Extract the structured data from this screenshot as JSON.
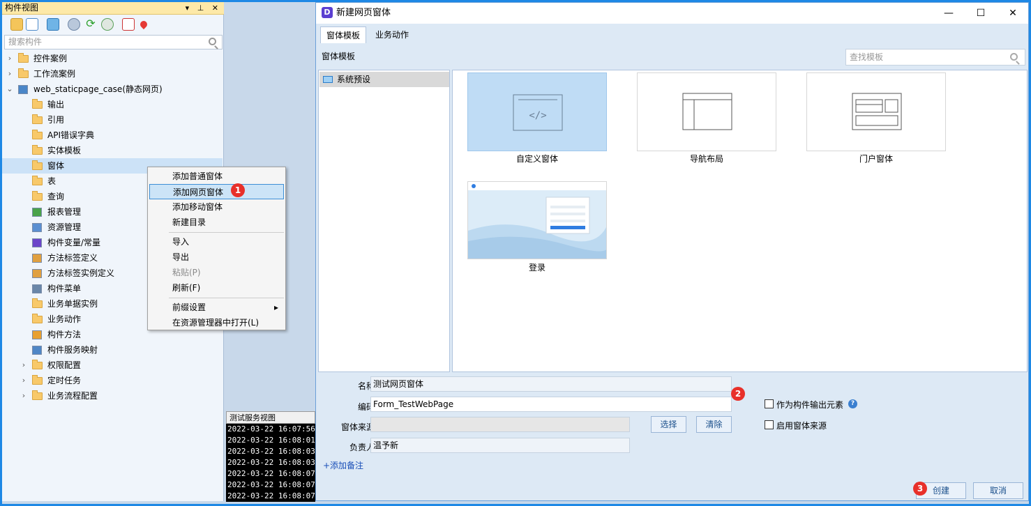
{
  "left_panel": {
    "title": "构件视图",
    "title_controls": "▾ ⊥ ✕",
    "search_placeholder": "搜索构件",
    "tree": [
      {
        "label": "控件案例",
        "twisty": "›",
        "type": "folder"
      },
      {
        "label": "工作流案例",
        "twisty": "›",
        "type": "folder"
      },
      {
        "label": "web_staticpage_case(静态网页)",
        "twisty": "⌄",
        "type": "project"
      },
      {
        "label": "输出",
        "type": "folder"
      },
      {
        "label": "引用",
        "type": "folder"
      },
      {
        "label": "API错误字典",
        "type": "folder"
      },
      {
        "label": "实体模板",
        "type": "folder"
      },
      {
        "label": "窗体",
        "type": "folder",
        "selected": true
      },
      {
        "label": "表",
        "type": "folder"
      },
      {
        "label": "查询",
        "type": "folder"
      },
      {
        "label": "报表管理",
        "type": "chart"
      },
      {
        "label": "资源管理",
        "type": "image"
      },
      {
        "label": "构件变量/常量",
        "type": "xy"
      },
      {
        "label": "方法标签定义",
        "type": "tag"
      },
      {
        "label": "方法标签实例定义",
        "type": "tag"
      },
      {
        "label": "构件菜单",
        "type": "menu"
      },
      {
        "label": "业务单据实例",
        "type": "folder"
      },
      {
        "label": "业务动作",
        "type": "folder"
      },
      {
        "label": "构件方法",
        "type": "api"
      },
      {
        "label": "构件服务映射",
        "type": "map"
      },
      {
        "label": "权限配置",
        "twisty": "›",
        "type": "folder"
      },
      {
        "label": "定时任务",
        "twisty": "›",
        "type": "folder"
      },
      {
        "label": "业务流程配置",
        "twisty": "›",
        "type": "folder"
      }
    ]
  },
  "context_menu": {
    "items": [
      {
        "label": "添加普通窗体"
      },
      {
        "label": "添加网页窗体",
        "highlighted": true
      },
      {
        "label": "添加移动窗体"
      },
      {
        "label": "新建目录"
      },
      {
        "label": "导入"
      },
      {
        "label": "导出"
      },
      {
        "label": "粘贴(P)",
        "disabled": true
      },
      {
        "label": "刷新(F)"
      },
      {
        "label": "前缀设置",
        "submenu": "▸"
      },
      {
        "label": "在资源管理器中打开(L)"
      }
    ]
  },
  "badges": {
    "one": "1",
    "two": "2",
    "three": "3"
  },
  "log_panel": {
    "title": "测试服务视图",
    "lines": [
      "2022-03-22 16:07:56 ]",
      "2022-03-22 16:08:01 ]",
      "2022-03-22 16:08:03 ]",
      "2022-03-22 16:08:03 ]",
      "2022-03-22 16:08:07 ]",
      "2022-03-22 16:08:07 ]",
      "2022-03-22 16:08:07 ]"
    ]
  },
  "dialog": {
    "title": "新建网页窗体",
    "logo": "D",
    "window_controls": {
      "minimize": "—",
      "maximize": "☐",
      "close": "✕"
    },
    "tabs": [
      {
        "label": "窗体模板",
        "active": true
      },
      {
        "label": "业务动作"
      }
    ],
    "section_label": "窗体模板",
    "search_placeholder": "查找模板",
    "category": "系统预设",
    "templates": [
      {
        "name": "自定义窗体",
        "selected": true
      },
      {
        "name": "导航布局"
      },
      {
        "name": "门户窗体"
      },
      {
        "name": "登录"
      }
    ],
    "form": {
      "name_label": "名称:",
      "name_value": "测试网页窗体",
      "code_label": "编码:",
      "code_value": "Form_TestWebPage",
      "source_label": "窗体来源:",
      "source_value": "",
      "owner_label": "负责人:",
      "owner_value": "温予新",
      "select_button": "选择",
      "clear_button": "清除",
      "add_note": "+添加备注",
      "output_checkbox": "作为构件输出元素",
      "enable_source_checkbox": "启用窗体来源",
      "help": "?"
    },
    "create_button": "创建",
    "cancel_button": "取消"
  }
}
